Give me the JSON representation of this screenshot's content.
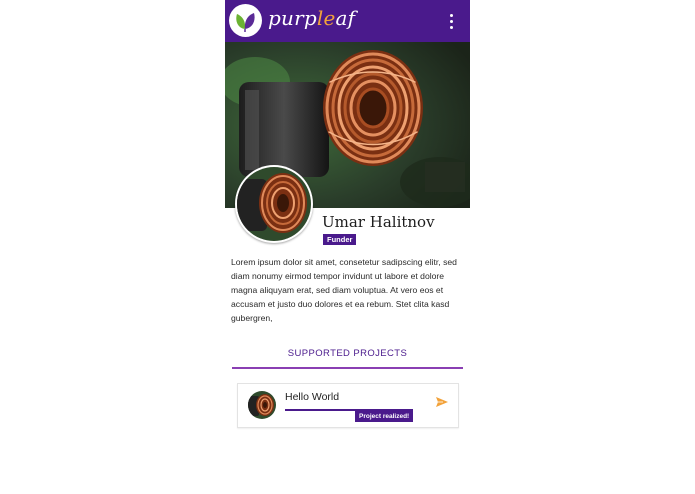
{
  "app": {
    "brand_prefix": "purp",
    "brand_highlight": "le",
    "brand_suffix": "af",
    "logo_icon": "leaf-logo-icon",
    "menu_icon": "more-vert-icon"
  },
  "profile": {
    "cover_image": "copper-coil-photo",
    "avatar_image": "copper-coil-photo",
    "name": "Umar Halitnov",
    "role": "Funder",
    "bio": "Lorem ipsum dolor sit amet, consetetur sadipscing elitr, sed diam nonumy eirmod tempor invidunt ut labore et dolore magna aliquyam erat, sed diam voluptua. At vero eos et accusam et justo duo dolores et ea rebum. Stet clita kasd gubergren,"
  },
  "tabs": {
    "active_label": "SUPPORTED PROJECTS"
  },
  "projects": [
    {
      "title": "Hello World",
      "status": "Project realized!",
      "progress": 1.0,
      "action_icon": "send-icon"
    }
  ],
  "colors": {
    "primary": "#4a1a8c",
    "accent": "#f2a23a",
    "tab_underline": "#8a3fb3"
  }
}
